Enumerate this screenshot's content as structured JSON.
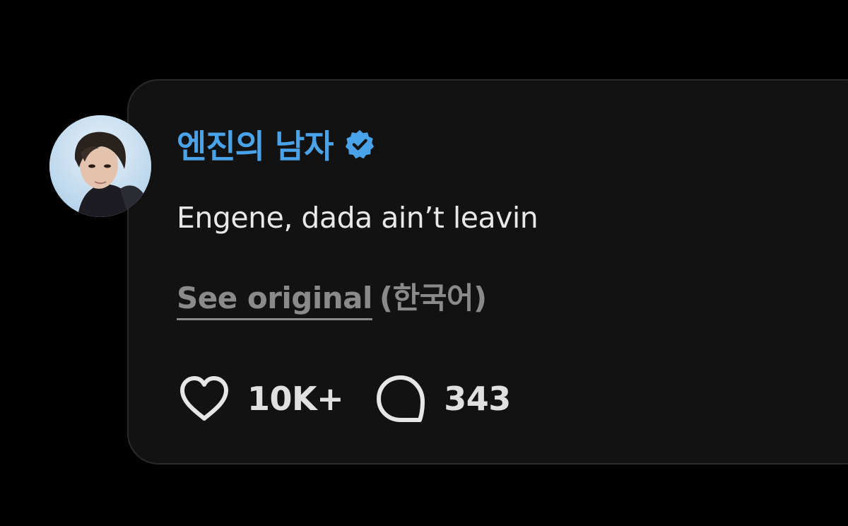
{
  "post": {
    "author": "엔진의 남자",
    "verified_icon": "verified-badge-icon",
    "text": "Engene, dada ain’t leavin",
    "see_original_label": "See original",
    "original_language": "(한국어)"
  },
  "actions": {
    "like_icon": "heart-icon",
    "like_count": "10K+",
    "reply_icon": "speech-bubble-icon",
    "reply_count": "343"
  },
  "colors": {
    "background": "#000000",
    "card": "#121212",
    "username": "#4aa3e8",
    "verified_badge": "#4aa3e8",
    "text": "#e8e8e8",
    "muted": "#8a8a8a"
  }
}
